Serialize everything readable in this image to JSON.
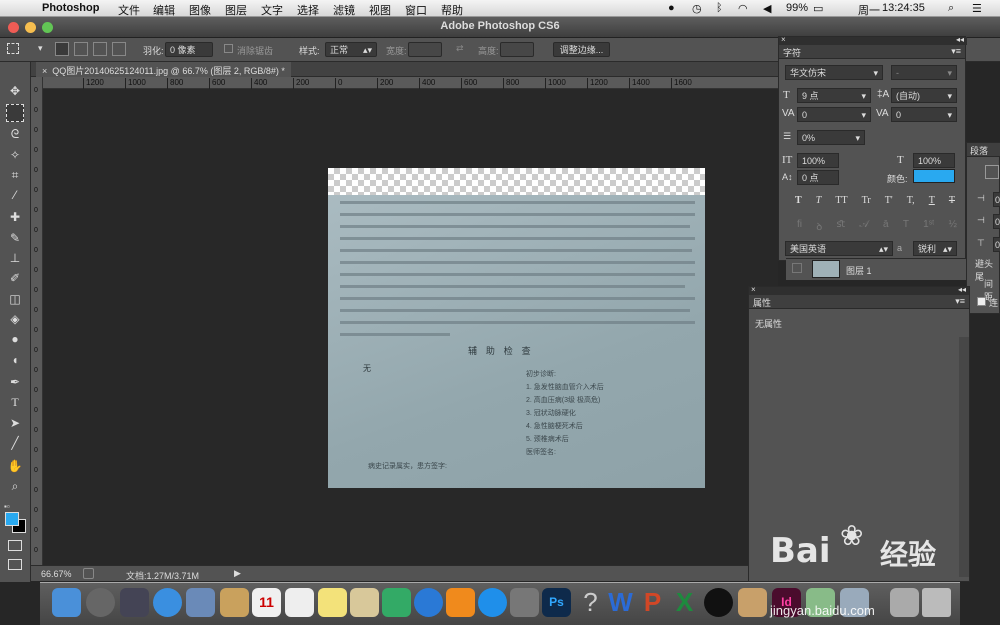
{
  "menubar": {
    "app_name": "Photoshop",
    "items": [
      "文件",
      "编辑",
      "图像",
      "图层",
      "文字",
      "选择",
      "滤镜",
      "视图",
      "窗口",
      "帮助"
    ],
    "battery": "99%",
    "day": "周一",
    "time": "13:24:35"
  },
  "window": {
    "title": "Adobe Photoshop CS6"
  },
  "options_bar": {
    "feather_label": "羽化:",
    "feather_value": "0 像素",
    "antialias_label": "消除锯齿",
    "style_label": "样式:",
    "style_value": "正常",
    "width_label": "宽度:",
    "height_label": "高度:",
    "refine_edge_button": "调整边缘..."
  },
  "document": {
    "tab_title": "QQ图片20140625124011.jpg @ 66.7% (图层 2, RGB/8#) *",
    "ruler_ticks": [
      "1200",
      "1000",
      "800",
      "600",
      "400",
      "200",
      "0",
      "200",
      "400",
      "600",
      "800",
      "1000",
      "1200",
      "1400",
      "1600"
    ],
    "vruler_ticks": [
      "0",
      "0",
      "0",
      "0",
      "0",
      "0",
      "0",
      "0",
      "0",
      "0",
      "0",
      "0",
      "0",
      "0",
      "0",
      "0",
      "0",
      "0",
      "0",
      "0",
      "0",
      "0",
      "0",
      "0"
    ],
    "image_text": {
      "heading": "辅 助 检 查",
      "left_char": "无",
      "diagnosis_title": "初步诊断:",
      "diagnosis_items": [
        "1. 急发性脑血管介入术后",
        "2. 高血压病(3级 极高危)",
        "3. 冠状动脉硬化",
        "4. 急性脑梗死术后",
        "5. 颈椎病术后"
      ],
      "signature": "医师签名:",
      "footer": "病史记录属实，患方签字:"
    }
  },
  "status_bar": {
    "zoom": "66.67%",
    "doc_size": "文档:1.27M/3.71M"
  },
  "character_panel": {
    "title": "字符",
    "font_family": "华文仿宋",
    "font_style": "-",
    "font_size": "9 点",
    "leading": "(自动)",
    "kerning": "0",
    "tracking": "0",
    "tsume": "0%",
    "vertical_scale": "100%",
    "horizontal_scale": "100%",
    "baseline_shift": "0 点",
    "color_label": "颜色:",
    "text_color": "#29a9f0",
    "language": "美国英语",
    "antialias_icon": "a",
    "antialias": "锐利",
    "style_buttons": [
      "T",
      "T",
      "TT",
      "Tr",
      "T'",
      "T,",
      "T",
      "T"
    ]
  },
  "paragraph_panel": {
    "title": "段落",
    "values": [
      "0",
      "0",
      "0"
    ],
    "avoid_label": "避头尾",
    "spacing_label": "间距",
    "hyphen_label": "连"
  },
  "layers": {
    "layer_name": "图层 1"
  },
  "properties_panel": {
    "title": "属性",
    "content": "无属性"
  },
  "watermark": {
    "brand": "Bai",
    "brand2": "经验",
    "url": "jingyan.baidu.com"
  },
  "colors": {
    "foreground": "#29a9f0",
    "background": "#000000",
    "panel_bg": "#535353"
  },
  "dock": {
    "calendar_day": "11"
  }
}
